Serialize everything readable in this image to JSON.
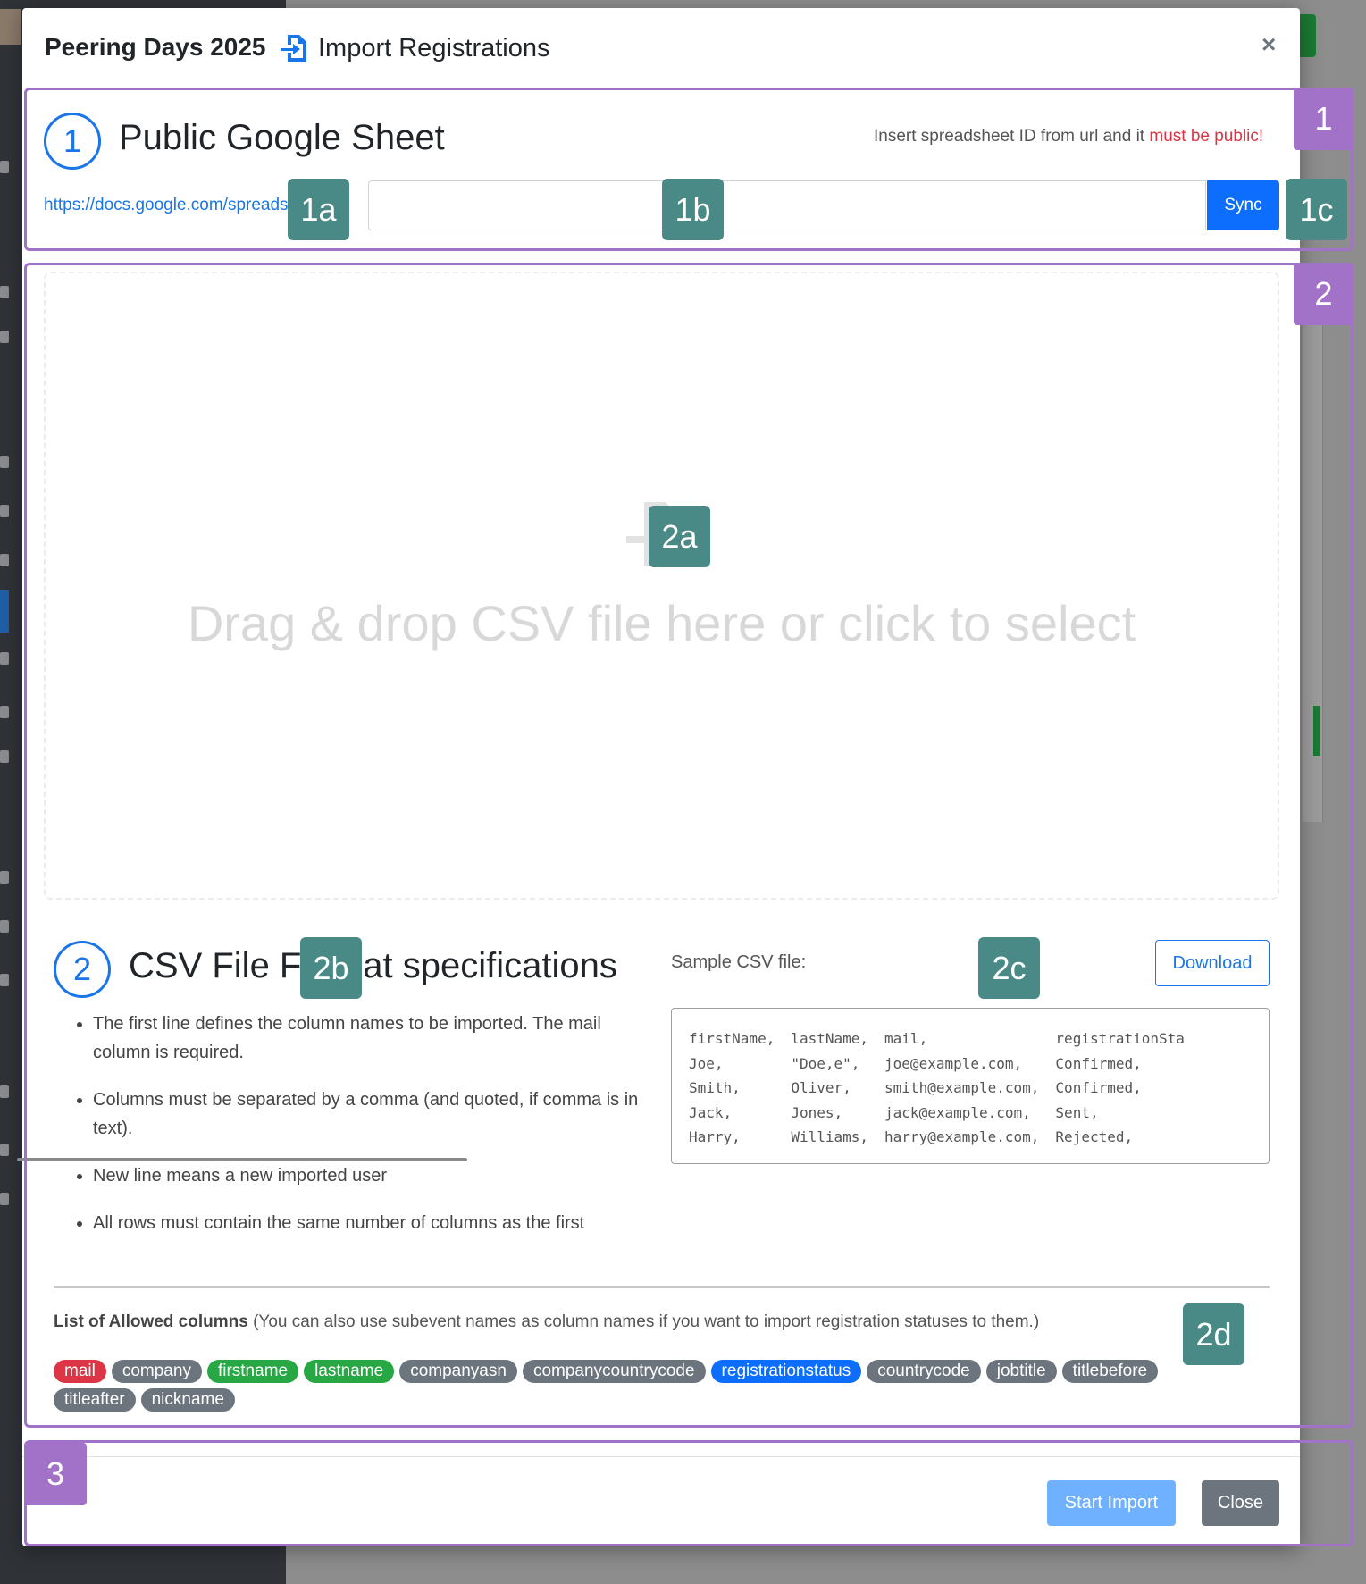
{
  "modal": {
    "event_title": "Peering Days 2025",
    "title": "Import Registrations",
    "close_symbol": "×",
    "title_icon": "import-file-icon"
  },
  "google_sheet": {
    "step": "1",
    "title": "Public Google Sheet",
    "hint_prefix": "Insert spreadsheet ID from url and it ",
    "hint_emphasis": "must be public!",
    "url_prefix": "https://docs.google.com/spreadsheets/d/",
    "input_value": "",
    "sync_label": "Sync"
  },
  "dropzone": {
    "text": "Drag & drop CSV file here or click to select",
    "icon": "upload-file-icon"
  },
  "csv_spec": {
    "step": "2",
    "title": "CSV File Format specifications",
    "rules": [
      "The first line defines the column names to be imported. The mail column is required.",
      "Columns must be separated by a comma (and quoted, if comma is in text).",
      "New line means a new imported user",
      "All rows must contain the same number of columns as the first"
    ],
    "sample_label": "Sample CSV file:",
    "download_label": "Download",
    "sample_rows": [
      [
        "firstName,",
        "lastName,",
        "mail,",
        "registrationSta"
      ],
      [
        "Joe,",
        "\"Doe,e\",",
        "joe@example.com,",
        "Confirmed,"
      ],
      [
        "Smith,",
        "Oliver,",
        "smith@example.com,",
        "Confirmed,"
      ],
      [
        "Jack,",
        "Jones,",
        "jack@example.com,",
        "Sent,"
      ],
      [
        "Harry,",
        "Williams,",
        "harry@example.com,",
        "Rejected,"
      ]
    ],
    "allowed_title": "List of Allowed columns",
    "allowed_note": " (You can also use subevent names as column names if you want to import registration statuses to them.)",
    "columns": [
      {
        "label": "mail",
        "color": "#dc3545"
      },
      {
        "label": "company",
        "color": "#6c757d"
      },
      {
        "label": "firstname",
        "color": "#28a745"
      },
      {
        "label": "lastname",
        "color": "#28a745"
      },
      {
        "label": "companyasn",
        "color": "#6c757d"
      },
      {
        "label": "companycountrycode",
        "color": "#6c757d"
      },
      {
        "label": "registrationstatus",
        "color": "#0d6efd"
      },
      {
        "label": "countrycode",
        "color": "#6c757d"
      },
      {
        "label": "jobtitle",
        "color": "#6c757d"
      },
      {
        "label": "titlebefore",
        "color": "#6c757d"
      },
      {
        "label": "titleafter",
        "color": "#6c757d"
      },
      {
        "label": "nickname",
        "color": "#6c757d"
      }
    ]
  },
  "footer": {
    "start_label": "Start Import",
    "close_label": "Close"
  },
  "annotations": {
    "sections": [
      "1",
      "2",
      "3"
    ],
    "callouts": [
      "1a",
      "1b",
      "1c",
      "2a",
      "2b",
      "2c",
      "2d"
    ]
  },
  "colors": {
    "accent": "#0d6efd",
    "annotation_frame": "#a272c9",
    "annotation_callout": "#4a8a86"
  }
}
